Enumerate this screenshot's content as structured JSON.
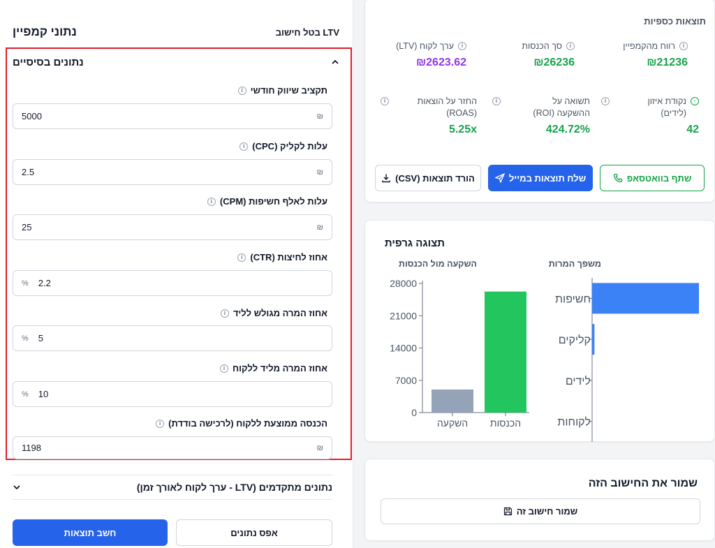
{
  "header": {
    "title": "נתוני קמפיין",
    "ltv_toggle": "LTV בטל חישוב"
  },
  "basic": {
    "title": "נתונים בסיסיים",
    "fields": [
      {
        "label": "תקציב שיווק חודשי",
        "value": "5000",
        "unit": "₪"
      },
      {
        "label": "עלות לקליק (CPC)",
        "value": "2.5",
        "unit": "₪"
      },
      {
        "label": "עלות לאלף חשיפות (CPM)",
        "value": "25",
        "unit": "₪"
      },
      {
        "label": "אחוז לחיצות (CTR)",
        "value": "2.2",
        "unit": "%"
      },
      {
        "label": "אחוז המרה מגולש לליד",
        "value": "5",
        "unit": "%"
      },
      {
        "label": "אחוז המרה מליד ללקוח",
        "value": "10",
        "unit": "%"
      },
      {
        "label": "הכנסה ממוצעת ללקוח (לרכישה בודדת)",
        "value": "1198",
        "unit": "₪"
      }
    ]
  },
  "advanced": {
    "title": "נתונים מתקדמים (LTV - ערך לקוח לאורך זמן)"
  },
  "actions": {
    "calculate": "חשב תוצאות",
    "reset": "אפס נתונים"
  },
  "results": {
    "title": "תוצאות כספיות",
    "metrics": [
      {
        "label": "רווח מהקמפיין",
        "value": "₪21236",
        "color": "#16a34a"
      },
      {
        "label": "סך הכנסות",
        "value": "₪26236",
        "color": "#16a34a"
      },
      {
        "label": "ערך לקוח (LTV)",
        "value": "₪2623.62",
        "color": "#9333ea"
      },
      {
        "label": "נקודת איזון (לידים)",
        "value": "42",
        "color": "#16a34a"
      },
      {
        "label": "תשואה על ההשקעה (ROI)",
        "value": "424.72%",
        "color": "#16a34a"
      },
      {
        "label": "החזר על הוצאות (ROAS)",
        "value": "5.25x",
        "color": "#16a34a"
      }
    ],
    "share_whatsapp": "שתף בוואטסאפ",
    "send_email": "שלח תוצאות במייל",
    "download_csv": "הורד תוצאות (CSV)"
  },
  "charts": {
    "title": "תצוגה גרפית"
  },
  "chart_data": [
    {
      "type": "bar",
      "title": "השקעה מול הכנסות",
      "categories": [
        "השקעה",
        "הכנסות"
      ],
      "values": [
        5000,
        26236
      ],
      "colors": [
        "#94a3b8",
        "#22c55e"
      ],
      "ylim": [
        0,
        28000
      ],
      "yticks": [
        0,
        7000,
        14000,
        21000,
        28000
      ],
      "grid": false
    },
    {
      "type": "bar",
      "orientation": "horizontal",
      "title": "משפך המרות",
      "categories": [
        "חשיפות",
        "קליקים",
        "לידים",
        "לקוחות"
      ],
      "values": [
        200000,
        4400,
        220,
        22
      ],
      "color": "#3b82f6",
      "grid": false
    }
  ],
  "save": {
    "title": "שמור את החישוב הזה",
    "button": "שמור חישוב זה"
  }
}
